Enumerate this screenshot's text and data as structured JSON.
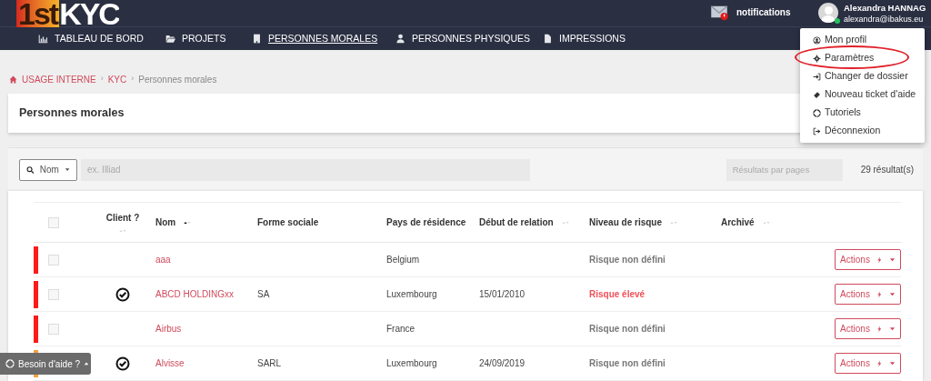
{
  "header": {
    "logo": {
      "part_1": "1st",
      "part_2": "KYC"
    },
    "notifications": {
      "label": "notifications",
      "alert": true
    },
    "user": {
      "name": "Alexandra HANNAG",
      "email": "alexandra@ibakus.eu",
      "online": true
    }
  },
  "nav": [
    {
      "label": "TABLEAU DE BORD",
      "selected": false
    },
    {
      "label": "PROJETS",
      "selected": false
    },
    {
      "label": "PERSONNES MORALES",
      "selected": true
    },
    {
      "label": "PERSONNES PHYSIQUES",
      "selected": false
    },
    {
      "label": "IMPRESSIONS",
      "selected": false
    }
  ],
  "user_menu": [
    {
      "label": "Mon profil",
      "highlighted": false
    },
    {
      "label": "Paramètres",
      "highlighted": true
    },
    {
      "label": "Changer de dossier",
      "highlighted": false
    },
    {
      "label": "Nouveau ticket d'aide",
      "highlighted": false
    },
    {
      "label": "Tutoriels",
      "highlighted": false
    },
    {
      "label": "Déconnexion",
      "highlighted": false
    }
  ],
  "breadcrumb": {
    "separator": "›",
    "items": [
      "USAGE INTERNE",
      "KYC",
      "Personnes morales"
    ]
  },
  "page_title": "Personnes morales",
  "filter": {
    "field": "Nom",
    "placeholder": "ex. Illiad",
    "per_page_placeholder": "Résultats par pages",
    "count": "29 résultat(s)"
  },
  "table": {
    "select_all_checked": false,
    "columns": [
      {
        "label": "Client ?",
        "sortable": true,
        "sorted": false
      },
      {
        "label": "Nom",
        "sortable": true,
        "sorted": true
      },
      {
        "label": "Forme sociale",
        "sortable": false
      },
      {
        "label": "Pays de résidence",
        "sortable": false
      },
      {
        "label": "Début de relation",
        "sortable": true,
        "sorted": false
      },
      {
        "label": "Niveau de risque",
        "sortable": true,
        "sorted": false
      },
      {
        "label": "Archivé",
        "sortable": true,
        "sorted": false
      }
    ],
    "rows": [
      {
        "color": "#ff1a1a",
        "checked": false,
        "client": false,
        "name": "aaa",
        "form": "",
        "country": "Belgium",
        "start": "",
        "risk": "Risque non défini",
        "high_risk": false,
        "action": "Actions"
      },
      {
        "color": "#ff1a1a",
        "checked": false,
        "client": true,
        "name": "ABCD HOLDINGxx",
        "form": "SA",
        "country": "Luxembourg",
        "start": "15/01/2010",
        "risk": "Risque élevé",
        "high_risk": true,
        "action": "Actions"
      },
      {
        "color": "#ff1a1a",
        "checked": false,
        "client": false,
        "name": "Airbus",
        "form": "",
        "country": "France",
        "start": "",
        "risk": "Risque non défini",
        "high_risk": false,
        "action": "Actions"
      },
      {
        "color": "#f5a13c",
        "client": true,
        "name": "Alvisse",
        "form": "SARL",
        "country": "Luxembourg",
        "start": "24/09/2019",
        "risk": "Risque non défini",
        "high_risk": false,
        "action": "Actions"
      }
    ]
  },
  "help_button": "Besoin d'aide ?"
}
